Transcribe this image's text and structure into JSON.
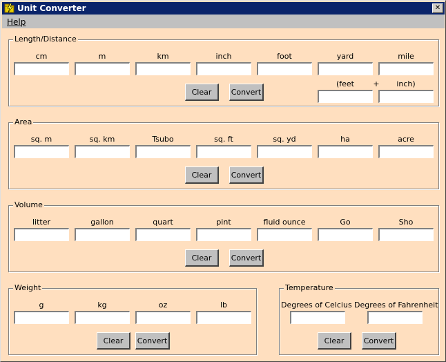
{
  "window": {
    "title": "Unit Converter",
    "close_symbol": "✕",
    "icon": "lightning-folder-icon"
  },
  "menu": {
    "help": "Help"
  },
  "length": {
    "legend": "Length/Distance",
    "labels": [
      "cm",
      "m",
      "km",
      "inch",
      "foot",
      "yard",
      "mile"
    ],
    "feet_label": "(feet",
    "plus_label": "+",
    "inch_label": "inch)",
    "clear": "Clear",
    "convert": "Convert"
  },
  "area": {
    "legend": "Area",
    "labels": [
      "sq. m",
      "sq. km",
      "Tsubo",
      "sq. ft",
      "sq. yd",
      "ha",
      "acre"
    ],
    "clear": "Clear",
    "convert": "Convert"
  },
  "volume": {
    "legend": "Volume",
    "labels": [
      "litter",
      "gallon",
      "quart",
      "pint",
      "fluid ounce",
      "Go",
      "Sho"
    ],
    "clear": "Clear",
    "convert": "Convert"
  },
  "weight": {
    "legend": "Weight",
    "labels": [
      "g",
      "kg",
      "oz",
      "lb"
    ],
    "clear": "Clear",
    "convert": "Convert"
  },
  "temperature": {
    "legend": "Temperature",
    "labels": [
      "Degrees of Celcius",
      "Degrees of Fahrenheit"
    ],
    "clear": "Clear",
    "convert": "Convert"
  }
}
